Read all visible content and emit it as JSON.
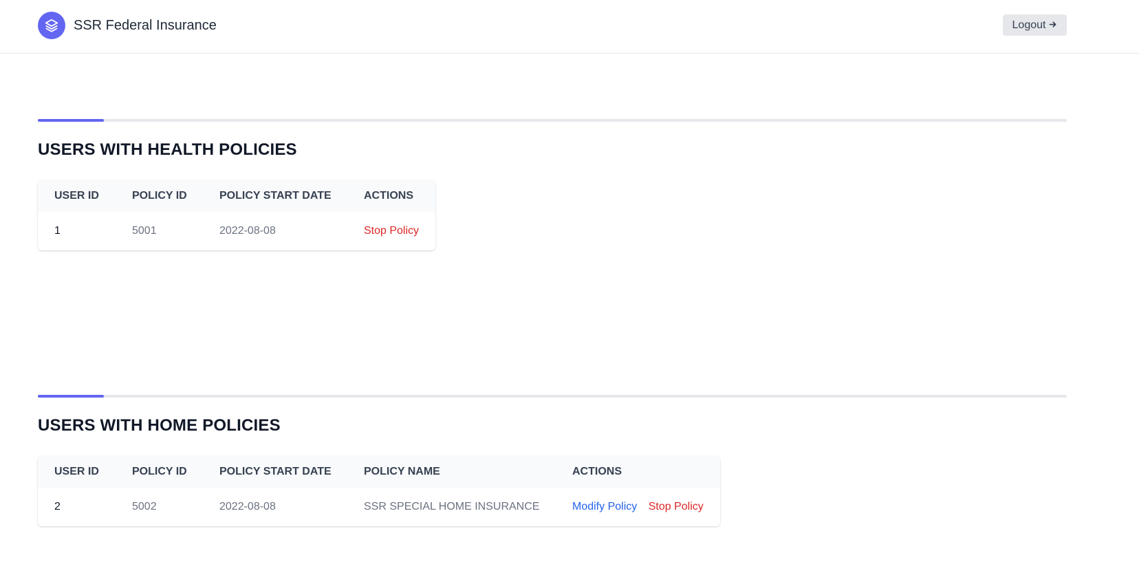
{
  "header": {
    "app_name": "SSR Federal Insurance",
    "logo_icon": "stack-layers-icon",
    "logout_label": "Logout",
    "logout_icon": "arrow-right-icon"
  },
  "colors": {
    "accent": "#6366f1",
    "stop": "#dc2626",
    "modify": "#2563eb"
  },
  "health": {
    "title": "USERS WITH HEALTH POLICIES",
    "columns": [
      "USER ID",
      "POLICY ID",
      "POLICY START DATE",
      "ACTIONS"
    ],
    "rows": [
      {
        "user_id": "1",
        "policy_id": "5001",
        "start_date": "2022-08-08",
        "stop_label": "Stop Policy"
      }
    ]
  },
  "home": {
    "title": "USERS WITH HOME POLICIES",
    "columns": [
      "USER ID",
      "POLICY ID",
      "POLICY START DATE",
      "POLICY NAME",
      "ACTIONS"
    ],
    "rows": [
      {
        "user_id": "2",
        "policy_id": "5002",
        "start_date": "2022-08-08",
        "policy_name": "SSR SPECIAL HOME INSURANCE",
        "modify_label": "Modify Policy",
        "stop_label": "Stop Policy"
      }
    ]
  }
}
